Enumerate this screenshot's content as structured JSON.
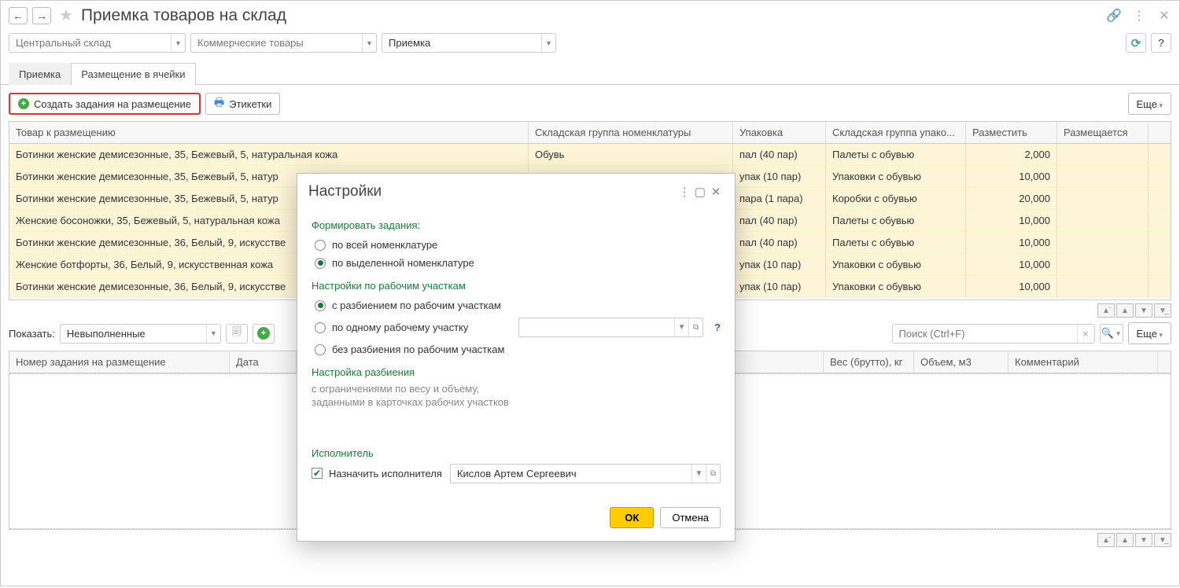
{
  "title": "Приемка товаров на склад",
  "nav": {
    "back": "←",
    "fwd": "→"
  },
  "filters": {
    "warehouse": "Центральный склад",
    "goods_type": "Коммерческие товары",
    "operation": "Приемка"
  },
  "tabs": {
    "t1": "Приемка",
    "t2": "Размещение в ячейки"
  },
  "toolbar": {
    "create_task": "Создать задания на размещение",
    "labels_btn": "Этикетки",
    "more": "Еще"
  },
  "grid1": {
    "cols": {
      "product": "Товар к размещению",
      "nomgroup": "Складская группа номенклатуры",
      "pack": "Упаковка",
      "packgroup": "Складская группа упако...",
      "place": "Разместить",
      "placed": "Размещается"
    },
    "rows": [
      {
        "product": "Ботинки женские демисезонные, 35, Бежевый, 5, натуральная кожа",
        "nomgroup": "Обувь",
        "pack": "пал (40 пар)",
        "packgroup": "Палеты с обувью",
        "place": "2,000"
      },
      {
        "product": "Ботинки женские демисезонные, 35, Бежевый, 5, натур",
        "nomgroup": "",
        "pack": "упак (10 пар)",
        "packgroup": "Упаковки с обувью",
        "place": "10,000"
      },
      {
        "product": "Ботинки женские демисезонные, 35, Бежевый, 5, натур",
        "nomgroup": "",
        "pack": "пара (1 пара)",
        "packgroup": "Коробки с обувью",
        "place": "20,000"
      },
      {
        "product": "Женские босоножки, 35, Бежевый, 5, натуральная кожа",
        "nomgroup": "",
        "pack": "пал (40 пар)",
        "packgroup": "Палеты с обувью",
        "place": "10,000"
      },
      {
        "product": "Ботинки женские демисезонные, 36, Белый, 9, искусстве",
        "nomgroup": "",
        "pack": "пал (40 пар)",
        "packgroup": "Палеты с обувью",
        "place": "10,000"
      },
      {
        "product": "Женские ботфорты, 36, Белый, 9, искусственная кожа",
        "nomgroup": "",
        "pack": "упак (10 пар)",
        "packgroup": "Упаковки с обувью",
        "place": "10,000"
      },
      {
        "product": "Ботинки женские демисезонные, 36, Белый, 9, искусстве",
        "nomgroup": "",
        "pack": "упак (10 пар)",
        "packgroup": "Упаковки с обувью",
        "place": "10,000"
      }
    ]
  },
  "lower": {
    "show_label": "Показать:",
    "show_value": "Невыполненные",
    "search_placeholder": "Поиск (Ctrl+F)",
    "more": "Еще"
  },
  "grid2": {
    "cols": {
      "num": "Номер задания на размещение",
      "date": "Дата",
      "gap": "",
      "weight": "Вес (брутто), кг",
      "volume": "Объем, м3",
      "comment": "Комментарий"
    }
  },
  "modal": {
    "title": "Настройки",
    "sec1": "Формировать задания:",
    "opt_all": "по всей номенклатуре",
    "opt_selected": "по выделенной номенклатуре",
    "sec2": "Настройки по рабочим участкам",
    "opt_split": "с разбиением по рабочим участкам",
    "opt_one": "по одному рабочему участку",
    "opt_none": "без разбиения по рабочим участкам",
    "sec3": "Настройка разбиения",
    "hint": "с ограничениями по весу и объему, заданными в карточках рабочих участков",
    "sec4": "Исполнитель",
    "assign_label": "Назначить исполнителя",
    "executor": "Кислов Артем Сергеевич",
    "ok": "ОК",
    "cancel": "Отмена",
    "help": "?"
  }
}
